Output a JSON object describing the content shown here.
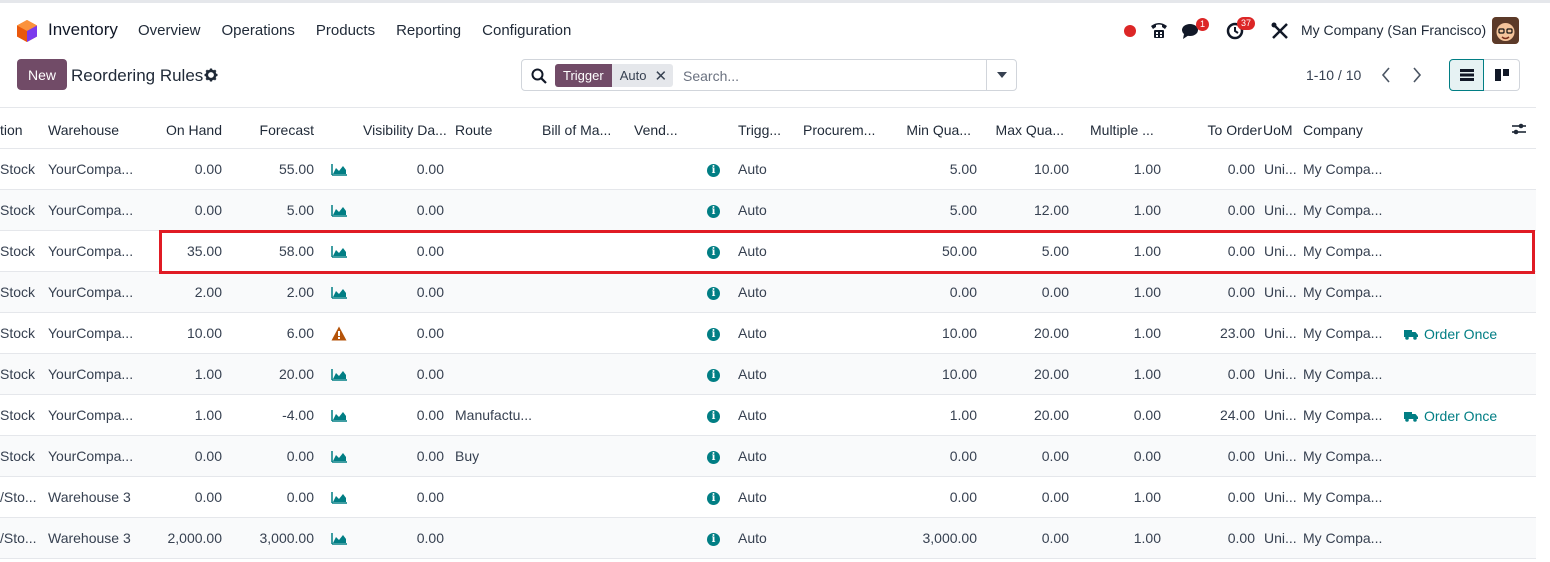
{
  "app": {
    "name": "Inventory"
  },
  "nav": {
    "items": [
      "Overview",
      "Operations",
      "Products",
      "Reporting",
      "Configuration"
    ]
  },
  "systray": {
    "messages_count": "1",
    "activities_count": "37",
    "company": "My Company (San Francisco)"
  },
  "control": {
    "new_label": "New",
    "title": "Reordering Rules"
  },
  "search": {
    "facet_label": "Trigger",
    "facet_value": "Auto",
    "placeholder": "Search..."
  },
  "pager": {
    "text": "1-10 / 10"
  },
  "table": {
    "headers": [
      "tion",
      "Warehouse",
      "On Hand",
      "Forecast",
      "Visibility Da...",
      "Route",
      "Bill of Ma...",
      "Vend...",
      "Trigg...",
      "Procurem...",
      "Min Qua...",
      "Max Qua...",
      "Multiple ...",
      "To Order",
      "UoM",
      "Company"
    ],
    "rows": [
      {
        "location": "Stock",
        "warehouse": "YourCompa...",
        "on_hand": "0.00",
        "forecast": "55.00",
        "forecast_icon": "chart",
        "visibility": "0.00",
        "route": "",
        "trigger": "Auto",
        "min": "5.00",
        "max": "10.00",
        "multiple": "1.00",
        "to_order": "0.00",
        "uom": "Uni...",
        "company": "My Compa...",
        "action": ""
      },
      {
        "location": "Stock",
        "warehouse": "YourCompa...",
        "on_hand": "0.00",
        "forecast": "5.00",
        "forecast_icon": "chart",
        "visibility": "0.00",
        "route": "",
        "trigger": "Auto",
        "min": "5.00",
        "max": "12.00",
        "multiple": "1.00",
        "to_order": "0.00",
        "uom": "Uni...",
        "company": "My Compa...",
        "action": ""
      },
      {
        "location": "Stock",
        "warehouse": "YourCompa...",
        "on_hand": "35.00",
        "forecast": "58.00",
        "forecast_icon": "chart",
        "visibility": "0.00",
        "route": "",
        "trigger": "Auto",
        "min": "50.00",
        "max": "5.00",
        "multiple": "1.00",
        "to_order": "0.00",
        "uom": "Uni...",
        "company": "My Compa...",
        "action": ""
      },
      {
        "location": "Stock",
        "warehouse": "YourCompa...",
        "on_hand": "2.00",
        "forecast": "2.00",
        "forecast_icon": "chart",
        "visibility": "0.00",
        "route": "",
        "trigger": "Auto",
        "min": "0.00",
        "max": "0.00",
        "multiple": "1.00",
        "to_order": "0.00",
        "uom": "Uni...",
        "company": "My Compa...",
        "action": ""
      },
      {
        "location": "Stock",
        "warehouse": "YourCompa...",
        "on_hand": "10.00",
        "forecast": "6.00",
        "forecast_icon": "warning",
        "visibility": "0.00",
        "route": "",
        "trigger": "Auto",
        "min": "10.00",
        "max": "20.00",
        "multiple": "1.00",
        "to_order": "23.00",
        "uom": "Uni...",
        "company": "My Compa...",
        "action": "Order Once"
      },
      {
        "location": "Stock",
        "warehouse": "YourCompa...",
        "on_hand": "1.00",
        "forecast": "20.00",
        "forecast_icon": "chart",
        "visibility": "0.00",
        "route": "",
        "trigger": "Auto",
        "min": "10.00",
        "max": "20.00",
        "multiple": "1.00",
        "to_order": "0.00",
        "uom": "Uni...",
        "company": "My Compa...",
        "action": ""
      },
      {
        "location": "Stock",
        "warehouse": "YourCompa...",
        "on_hand": "1.00",
        "forecast": "-4.00",
        "forecast_icon": "chart",
        "visibility": "0.00",
        "route": "Manufactu...",
        "trigger": "Auto",
        "min": "1.00",
        "max": "20.00",
        "multiple": "0.00",
        "to_order": "24.00",
        "uom": "Uni...",
        "company": "My Compa...",
        "action": "Order Once"
      },
      {
        "location": "Stock",
        "warehouse": "YourCompa...",
        "on_hand": "0.00",
        "forecast": "0.00",
        "forecast_icon": "chart",
        "visibility": "0.00",
        "route": "Buy",
        "trigger": "Auto",
        "min": "0.00",
        "max": "0.00",
        "multiple": "0.00",
        "to_order": "0.00",
        "uom": "Uni...",
        "company": "My Compa...",
        "action": ""
      },
      {
        "location": "/Sto...",
        "warehouse": "Warehouse 3",
        "on_hand": "0.00",
        "forecast": "0.00",
        "forecast_icon": "chart",
        "visibility": "0.00",
        "route": "",
        "trigger": "Auto",
        "min": "0.00",
        "max": "0.00",
        "multiple": "1.00",
        "to_order": "0.00",
        "uom": "Uni...",
        "company": "My Compa...",
        "action": ""
      },
      {
        "location": "/Sto...",
        "warehouse": "Warehouse 3",
        "on_hand": "2,000.00",
        "forecast": "3,000.00",
        "forecast_icon": "chart",
        "visibility": "0.00",
        "route": "",
        "trigger": "Auto",
        "min": "3,000.00",
        "max": "0.00",
        "multiple": "1.00",
        "to_order": "0.00",
        "uom": "Uni...",
        "company": "My Compa...",
        "action": ""
      }
    ]
  },
  "colors": {
    "brand": "#714b67",
    "accent": "#017e84",
    "highlight": "#e01b24",
    "warning": "#b45309"
  }
}
